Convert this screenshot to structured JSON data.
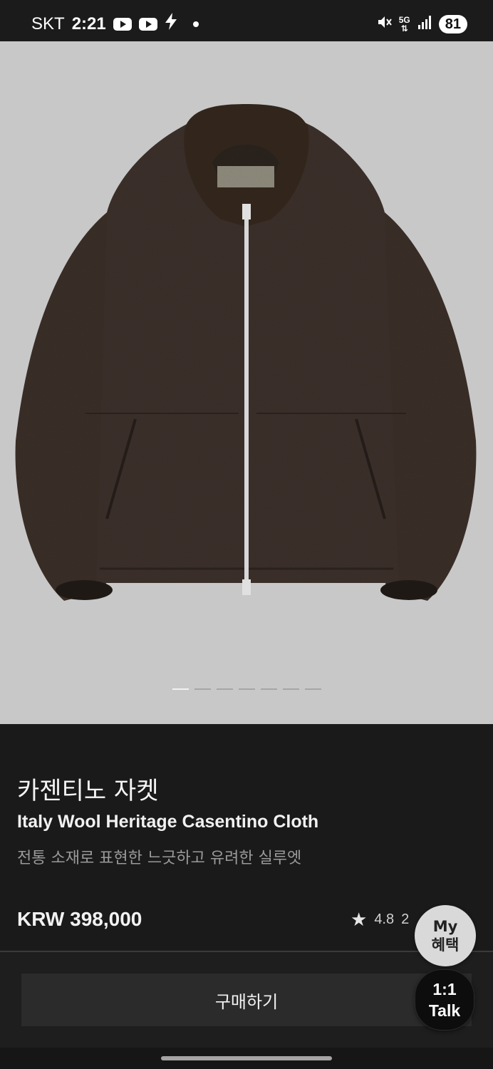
{
  "status_bar": {
    "carrier": "SKT",
    "time": "2:21",
    "network": "5G",
    "battery": "81"
  },
  "product": {
    "image_alt": "Dark brown wool zip-up jacket",
    "carousel_total": 7,
    "carousel_active": 1,
    "name_ko": "카젠티노 자켓",
    "name_en": "Italy Wool Heritage Casentino Cloth",
    "tagline": "전통 소재로 표현한 느긋하고 유려한 실루엣",
    "price": "KRW 398,000",
    "rating": "4.8",
    "review_count_partial": "2"
  },
  "actions": {
    "buy_label": "구매하기"
  },
  "floating": {
    "my_line1": "My",
    "my_line2": "혜택",
    "talk_line1": "1:1",
    "talk_line2": "Talk"
  },
  "colors": {
    "background": "#1a1a1a",
    "image_bg": "#c8c8c8",
    "jacket": "#3a2e29"
  }
}
